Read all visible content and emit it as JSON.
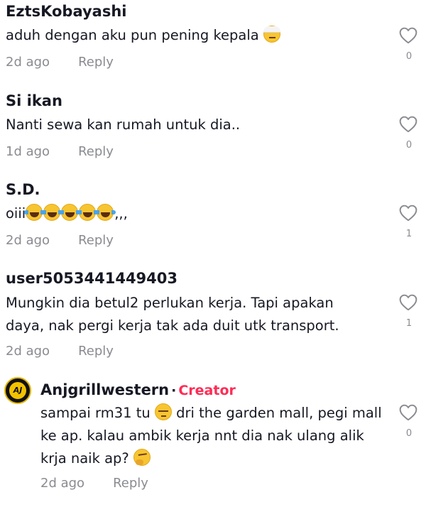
{
  "comments": [
    {
      "user": "EztsKobayashi",
      "text": "aduh dengan aku pun pening kepala",
      "time": "2d ago",
      "reply": "Reply",
      "likes": "0"
    },
    {
      "user": "Si ikan",
      "text": "Nanti sewa kan rumah untuk dia..",
      "time": "1d ago",
      "reply": "Reply",
      "likes": "0"
    },
    {
      "user": "S.D.",
      "text_prefix": "oiii",
      "text_suffix": ",,,",
      "time": "2d ago",
      "reply": "Reply",
      "likes": "1"
    },
    {
      "user": "user5053441449403",
      "text_line1": "Mungkin dia betul2 perlukan kerja. Tapi apakan",
      "text_line2": "daya, nak pergi kerja tak ada duit utk transport.",
      "time": "2d ago",
      "reply": "Reply",
      "likes": "1"
    }
  ],
  "reply": {
    "user": "Anjgrillwestern",
    "separator": "·",
    "badge": "Creator",
    "avatar_text": "AJ",
    "line1_a": "sampai rm31 tu",
    "line1_b": "dri the garden mall, pegi mall",
    "line2": "ke ap. kalau ambik kerja nnt dia nak ulang alik",
    "line3": "krja naik ap?",
    "time": "2d ago",
    "reply": "Reply",
    "likes": "0"
  },
  "colors": {
    "creator": "#fe2c55",
    "muted": "#8a8b91",
    "text": "#161823"
  },
  "icons": {
    "like": "heart-outline-icon",
    "laugh": "face-with-tears-of-joy-emoji",
    "bandage": "face-with-head-bandage-emoji",
    "pensive": "pensive-face-emoji",
    "thinking": "thinking-face-emoji"
  }
}
